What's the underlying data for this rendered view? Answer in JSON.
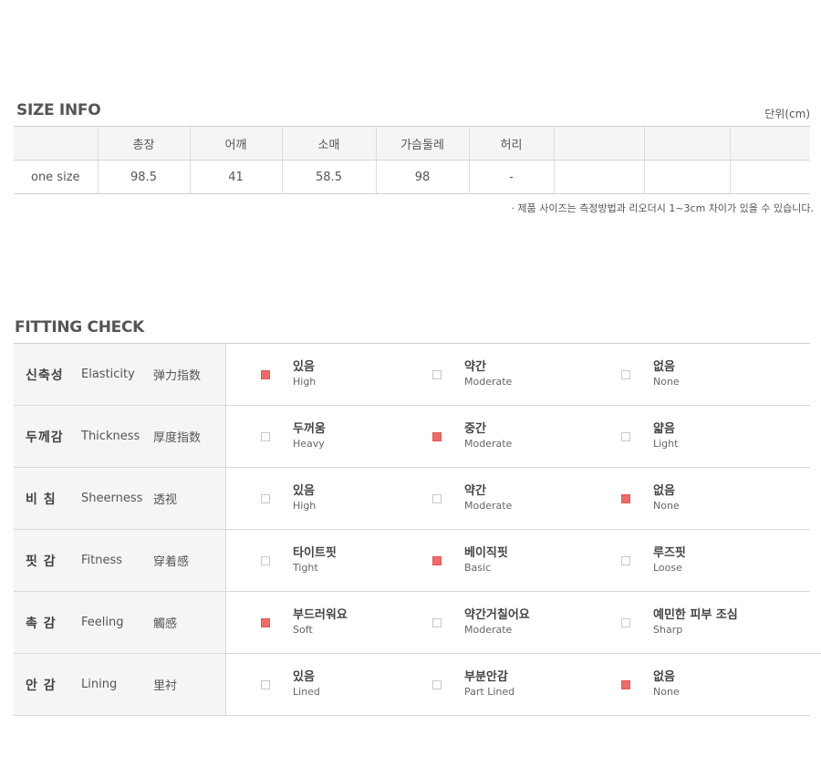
{
  "size_info": {
    "title": "SIZE INFO",
    "unit": "단위(cm)",
    "headers": [
      "",
      "총장",
      "어깨",
      "소매",
      "가슴둘레",
      "허리",
      "",
      "",
      ""
    ],
    "rows": [
      [
        "one size",
        "98.5",
        "41",
        "58.5",
        "98",
        "-",
        "",
        "",
        ""
      ]
    ],
    "note": "· 제품 사이즈는 측정방법과 리오더시 1~3cm 차이가 있을 수 있습니다."
  },
  "fitting_check": {
    "title": "FITTING CHECK",
    "rows": [
      {
        "ko": "신축성",
        "en": "Elasticity",
        "zh": "弹力指数",
        "selected": 0,
        "options": [
          {
            "ko": "있음",
            "en": "High"
          },
          {
            "ko": "약간",
            "en": "Moderate"
          },
          {
            "ko": "없음",
            "en": "None"
          }
        ]
      },
      {
        "ko": "두께감",
        "en": "Thickness",
        "zh": "厚度指数",
        "selected": 1,
        "options": [
          {
            "ko": "두꺼움",
            "en": "Heavy"
          },
          {
            "ko": "중간",
            "en": "Moderate"
          },
          {
            "ko": "얇음",
            "en": "Light"
          }
        ]
      },
      {
        "ko": "비  침",
        "en": "Sheerness",
        "zh": "透视",
        "selected": 2,
        "options": [
          {
            "ko": "있음",
            "en": "High"
          },
          {
            "ko": "약간",
            "en": "Moderate"
          },
          {
            "ko": "없음",
            "en": "None"
          }
        ]
      },
      {
        "ko": "핏  감",
        "en": "Fitness",
        "zh": "穿着感",
        "selected": 1,
        "options": [
          {
            "ko": "타이트핏",
            "en": "Tight"
          },
          {
            "ko": "베이직핏",
            "en": "Basic"
          },
          {
            "ko": "루즈핏",
            "en": "Loose"
          }
        ]
      },
      {
        "ko": "촉  감",
        "en": "Feeling",
        "zh": "觸感",
        "selected": 0,
        "options": [
          {
            "ko": "부드러워요",
            "en": "Soft"
          },
          {
            "ko": "약간거칠어요",
            "en": "Moderate"
          },
          {
            "ko": "예민한 피부 조심",
            "en": "Sharp"
          }
        ]
      },
      {
        "ko": "안  감",
        "en": "Lining",
        "zh": "里衬",
        "selected": 2,
        "options": [
          {
            "ko": "있음",
            "en": "Lined"
          },
          {
            "ko": "부분안감",
            "en": "Part Lined"
          },
          {
            "ko": "없음",
            "en": "None"
          }
        ]
      }
    ]
  },
  "colors": {
    "checked": "#ef6a6a",
    "header_bg": "#f5f5f5",
    "border": "#d8d8d8"
  }
}
